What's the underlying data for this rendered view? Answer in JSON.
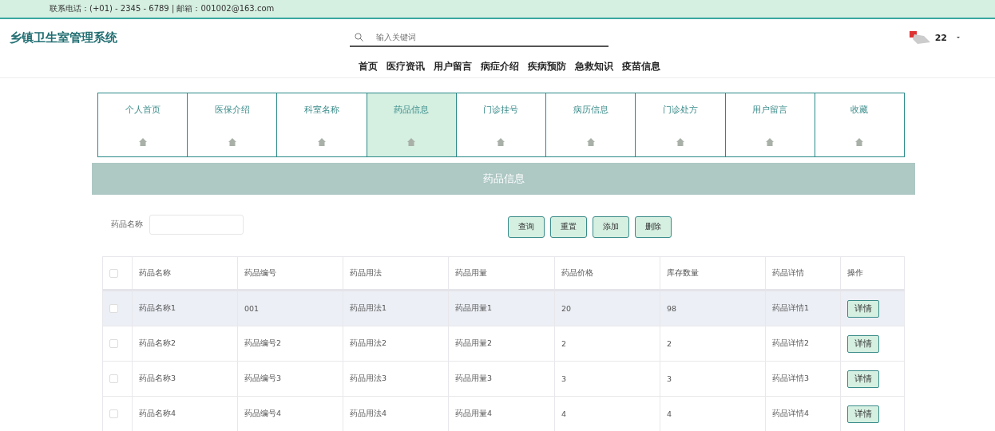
{
  "top_bar": {
    "contact": "联系电话：(+01) - 2345 - 6789 | 邮箱：001002@163.com"
  },
  "header": {
    "title": "乡镇卫生室管理系统",
    "search": {
      "placeholder": "输入关键词"
    },
    "user": {
      "name": "22"
    }
  },
  "nav": [
    {
      "label": "首页"
    },
    {
      "label": "医疗资讯"
    },
    {
      "label": "用户留言"
    },
    {
      "label": "病症介绍"
    },
    {
      "label": "疾病预防"
    },
    {
      "label": "急救知识"
    },
    {
      "label": "疫苗信息"
    }
  ],
  "tabs": [
    {
      "label": "个人首页",
      "selected": false
    },
    {
      "label": "医保介绍",
      "selected": false
    },
    {
      "label": "科室名称",
      "selected": false
    },
    {
      "label": "药品信息",
      "selected": true
    },
    {
      "label": "门诊挂号",
      "selected": false
    },
    {
      "label": "病历信息",
      "selected": false
    },
    {
      "label": "门诊处方",
      "selected": false
    },
    {
      "label": "用户留言",
      "selected": false
    },
    {
      "label": "收藏",
      "selected": false
    }
  ],
  "section_title": "药品信息",
  "filter": {
    "label": "药品名称",
    "buttons": [
      "查询",
      "重置",
      "添加",
      "删除"
    ]
  },
  "table": {
    "select_all_checked": false,
    "columns": [
      "药品名称",
      "药品编号",
      "药品用法",
      "药品用量",
      "药品价格",
      "库存数量",
      "药品详情",
      "操作"
    ],
    "rows": [
      {
        "checked": false,
        "highlighted": true,
        "cells": [
          "药品名称1",
          "001",
          "药品用法1",
          "药品用量1",
          "20",
          "98",
          "药品详情1"
        ],
        "action": "详情"
      },
      {
        "checked": false,
        "highlighted": false,
        "cells": [
          "药品名称2",
          "药品编号2",
          "药品用法2",
          "药品用量2",
          "2",
          "2",
          "药品详情2"
        ],
        "action": "详情"
      },
      {
        "checked": false,
        "highlighted": false,
        "cells": [
          "药品名称3",
          "药品编号3",
          "药品用法3",
          "药品用量3",
          "3",
          "3",
          "药品详情3"
        ],
        "action": "详情"
      },
      {
        "checked": false,
        "highlighted": false,
        "cells": [
          "药品名称4",
          "药品编号4",
          "药品用法4",
          "药品用量4",
          "4",
          "4",
          "药品详情4"
        ],
        "action": "详情"
      }
    ]
  }
}
